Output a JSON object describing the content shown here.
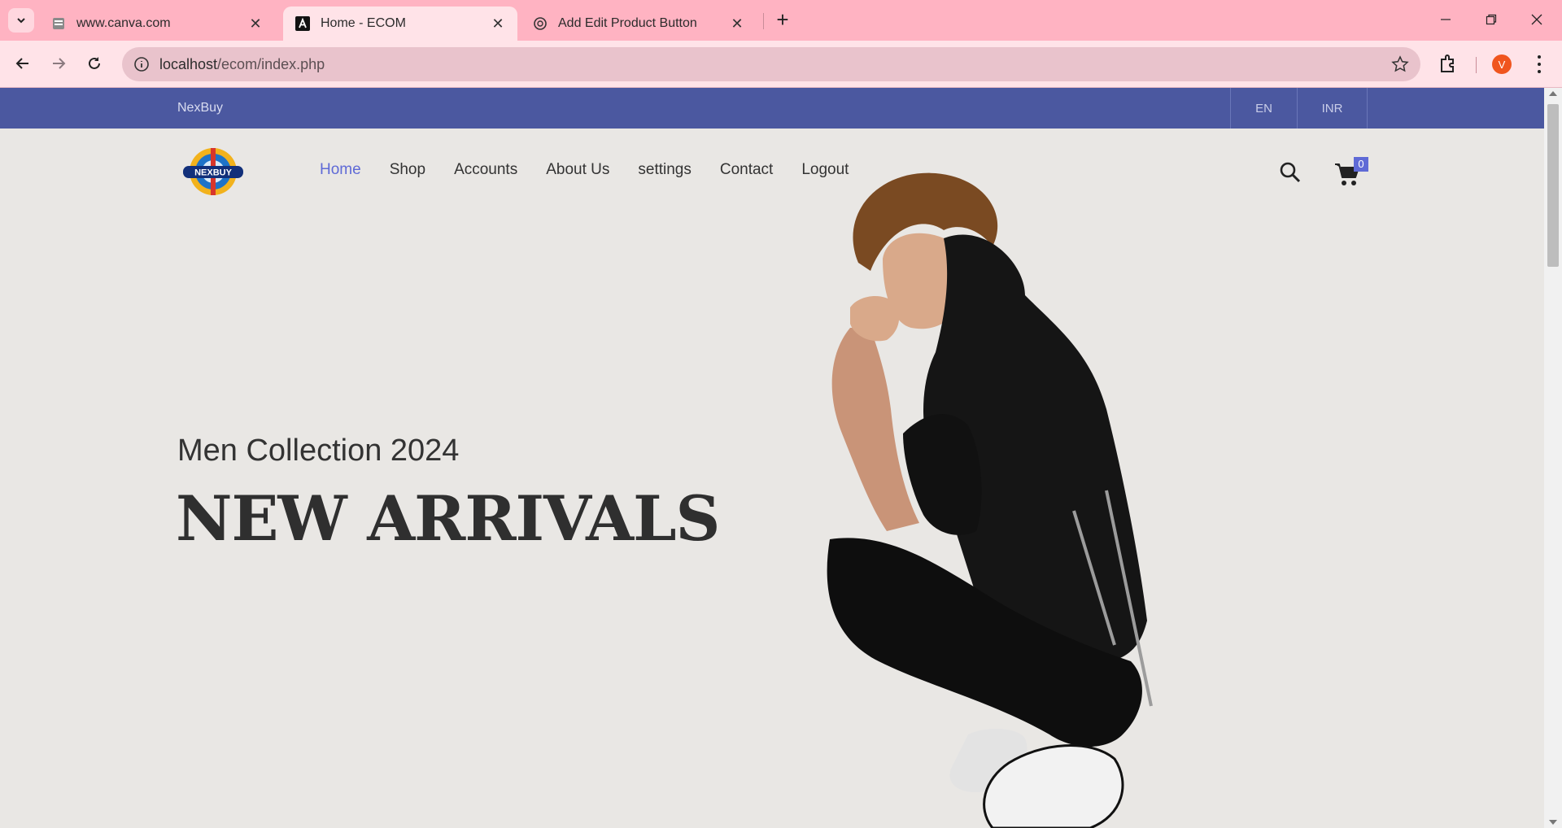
{
  "browser": {
    "tabs": [
      {
        "title": "www.canva.com",
        "active": false,
        "favicon": "document-icon"
      },
      {
        "title": "Home - ECOM",
        "active": true,
        "favicon": "angular-a-icon"
      },
      {
        "title": "Add Edit Product Button",
        "active": false,
        "favicon": "chatgpt-icon"
      }
    ],
    "url_host": "localhost",
    "url_path": "/ecom/index.php",
    "profile_initial": "V"
  },
  "site": {
    "topbar": {
      "brand": "NexBuy",
      "language": "EN",
      "currency": "INR"
    },
    "logo_text": "NEXBUY",
    "nav": [
      {
        "label": "Home",
        "active": true
      },
      {
        "label": "Shop",
        "active": false
      },
      {
        "label": "Accounts",
        "active": false
      },
      {
        "label": "About Us",
        "active": false
      },
      {
        "label": "settings",
        "active": false
      },
      {
        "label": "Contact",
        "active": false
      },
      {
        "label": "Logout",
        "active": false
      }
    ],
    "cart_count": "0",
    "hero": {
      "subtitle": "Men Collection 2024",
      "title": "NEW ARRIVALS"
    }
  },
  "colors": {
    "tabbar": "#ffb3c2",
    "topbar": "#4b58a0",
    "accent": "#5f6ad6",
    "page_bg": "#e9e7e4"
  }
}
